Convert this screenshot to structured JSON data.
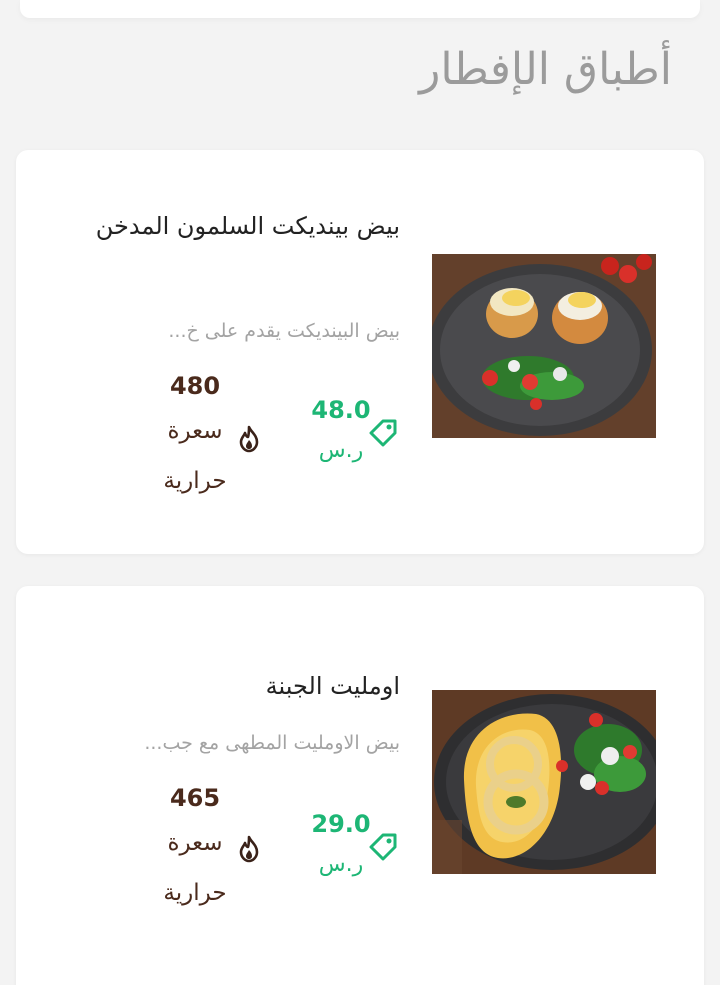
{
  "section": {
    "title": "أطباق الإفطار"
  },
  "colors": {
    "price": "#1db675",
    "calories": "#4a2a1c",
    "title": "#9b9b9b"
  },
  "items": [
    {
      "name": "بيض بينديكت السلمون المدخن",
      "description": "بيض البينديكت يقدم على خ...",
      "price": "48.0",
      "currency": "ر.س",
      "calories": "480",
      "calories_unit": "سعرة حرارية",
      "image": "eggs-benedict-plate"
    },
    {
      "name": "اومليت الجبنة",
      "description": "بيض الاومليت المطهى مع جب...",
      "price": "29.0",
      "currency": "ر.س",
      "calories": "465",
      "calories_unit": "سعرة حرارية",
      "image": "cheese-omelette-plate"
    }
  ]
}
